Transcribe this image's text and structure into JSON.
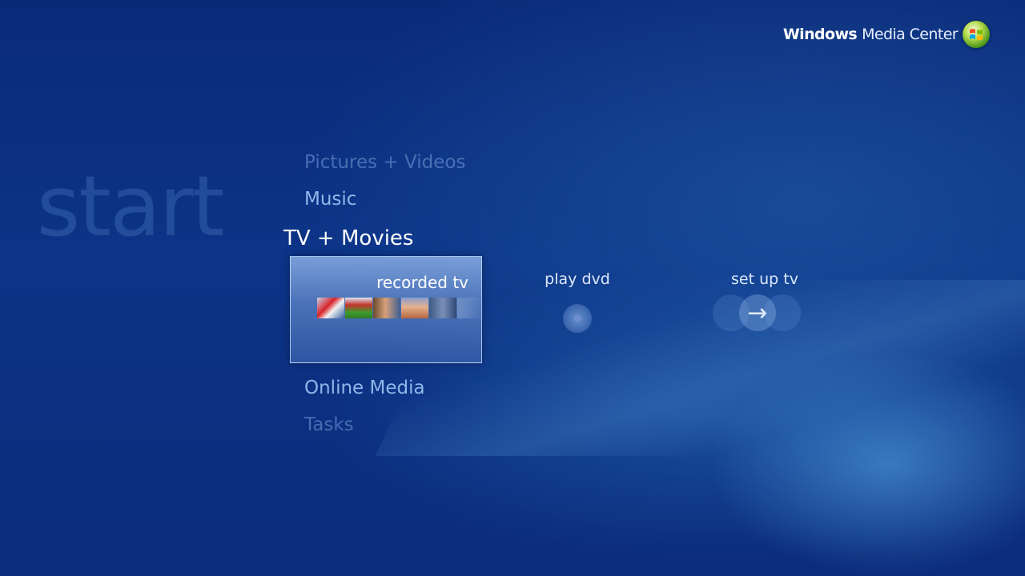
{
  "brand": {
    "name_bold": "Windows",
    "name_light": "Media Center",
    "logo_icon": "windows-orb-icon"
  },
  "page": {
    "title": "start"
  },
  "menu": {
    "items": [
      {
        "label": "Pictures + Videos",
        "state": "faded"
      },
      {
        "label": "Music",
        "state": "normal"
      },
      {
        "label": "TV + Movies",
        "state": "selected"
      },
      {
        "label": "Online Media",
        "state": "normal"
      },
      {
        "label": "Tasks",
        "state": "faded"
      }
    ]
  },
  "strip": {
    "tiles": [
      {
        "label": "recorded tv",
        "focused": true,
        "icon": "recorded-tv-thumbnails"
      },
      {
        "label": "play dvd",
        "focused": false,
        "icon": "dvd-disc-icon"
      },
      {
        "label": "set up tv",
        "focused": false,
        "icon": "arrow-right-icon"
      }
    ]
  },
  "colors": {
    "background": "#0b2c7a",
    "menu_text": "#8fb7ea",
    "selected_text": "#ffffff",
    "logo_green": "#7fc02a"
  }
}
